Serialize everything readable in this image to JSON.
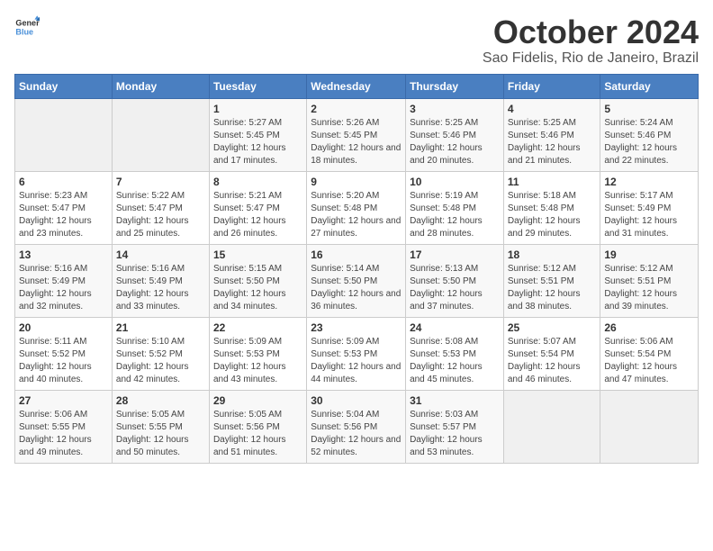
{
  "header": {
    "logo_line1": "General",
    "logo_line2": "Blue",
    "title": "October 2024",
    "subtitle": "Sao Fidelis, Rio de Janeiro, Brazil"
  },
  "days_of_week": [
    "Sunday",
    "Monday",
    "Tuesday",
    "Wednesday",
    "Thursday",
    "Friday",
    "Saturday"
  ],
  "weeks": [
    [
      {
        "day": "",
        "sunrise": "",
        "sunset": "",
        "daylight": ""
      },
      {
        "day": "",
        "sunrise": "",
        "sunset": "",
        "daylight": ""
      },
      {
        "day": "1",
        "sunrise": "Sunrise: 5:27 AM",
        "sunset": "Sunset: 5:45 PM",
        "daylight": "Daylight: 12 hours and 17 minutes."
      },
      {
        "day": "2",
        "sunrise": "Sunrise: 5:26 AM",
        "sunset": "Sunset: 5:45 PM",
        "daylight": "Daylight: 12 hours and 18 minutes."
      },
      {
        "day": "3",
        "sunrise": "Sunrise: 5:25 AM",
        "sunset": "Sunset: 5:46 PM",
        "daylight": "Daylight: 12 hours and 20 minutes."
      },
      {
        "day": "4",
        "sunrise": "Sunrise: 5:25 AM",
        "sunset": "Sunset: 5:46 PM",
        "daylight": "Daylight: 12 hours and 21 minutes."
      },
      {
        "day": "5",
        "sunrise": "Sunrise: 5:24 AM",
        "sunset": "Sunset: 5:46 PM",
        "daylight": "Daylight: 12 hours and 22 minutes."
      }
    ],
    [
      {
        "day": "6",
        "sunrise": "Sunrise: 5:23 AM",
        "sunset": "Sunset: 5:47 PM",
        "daylight": "Daylight: 12 hours and 23 minutes."
      },
      {
        "day": "7",
        "sunrise": "Sunrise: 5:22 AM",
        "sunset": "Sunset: 5:47 PM",
        "daylight": "Daylight: 12 hours and 25 minutes."
      },
      {
        "day": "8",
        "sunrise": "Sunrise: 5:21 AM",
        "sunset": "Sunset: 5:47 PM",
        "daylight": "Daylight: 12 hours and 26 minutes."
      },
      {
        "day": "9",
        "sunrise": "Sunrise: 5:20 AM",
        "sunset": "Sunset: 5:48 PM",
        "daylight": "Daylight: 12 hours and 27 minutes."
      },
      {
        "day": "10",
        "sunrise": "Sunrise: 5:19 AM",
        "sunset": "Sunset: 5:48 PM",
        "daylight": "Daylight: 12 hours and 28 minutes."
      },
      {
        "day": "11",
        "sunrise": "Sunrise: 5:18 AM",
        "sunset": "Sunset: 5:48 PM",
        "daylight": "Daylight: 12 hours and 29 minutes."
      },
      {
        "day": "12",
        "sunrise": "Sunrise: 5:17 AM",
        "sunset": "Sunset: 5:49 PM",
        "daylight": "Daylight: 12 hours and 31 minutes."
      }
    ],
    [
      {
        "day": "13",
        "sunrise": "Sunrise: 5:16 AM",
        "sunset": "Sunset: 5:49 PM",
        "daylight": "Daylight: 12 hours and 32 minutes."
      },
      {
        "day": "14",
        "sunrise": "Sunrise: 5:16 AM",
        "sunset": "Sunset: 5:49 PM",
        "daylight": "Daylight: 12 hours and 33 minutes."
      },
      {
        "day": "15",
        "sunrise": "Sunrise: 5:15 AM",
        "sunset": "Sunset: 5:50 PM",
        "daylight": "Daylight: 12 hours and 34 minutes."
      },
      {
        "day": "16",
        "sunrise": "Sunrise: 5:14 AM",
        "sunset": "Sunset: 5:50 PM",
        "daylight": "Daylight: 12 hours and 36 minutes."
      },
      {
        "day": "17",
        "sunrise": "Sunrise: 5:13 AM",
        "sunset": "Sunset: 5:50 PM",
        "daylight": "Daylight: 12 hours and 37 minutes."
      },
      {
        "day": "18",
        "sunrise": "Sunrise: 5:12 AM",
        "sunset": "Sunset: 5:51 PM",
        "daylight": "Daylight: 12 hours and 38 minutes."
      },
      {
        "day": "19",
        "sunrise": "Sunrise: 5:12 AM",
        "sunset": "Sunset: 5:51 PM",
        "daylight": "Daylight: 12 hours and 39 minutes."
      }
    ],
    [
      {
        "day": "20",
        "sunrise": "Sunrise: 5:11 AM",
        "sunset": "Sunset: 5:52 PM",
        "daylight": "Daylight: 12 hours and 40 minutes."
      },
      {
        "day": "21",
        "sunrise": "Sunrise: 5:10 AM",
        "sunset": "Sunset: 5:52 PM",
        "daylight": "Daylight: 12 hours and 42 minutes."
      },
      {
        "day": "22",
        "sunrise": "Sunrise: 5:09 AM",
        "sunset": "Sunset: 5:53 PM",
        "daylight": "Daylight: 12 hours and 43 minutes."
      },
      {
        "day": "23",
        "sunrise": "Sunrise: 5:09 AM",
        "sunset": "Sunset: 5:53 PM",
        "daylight": "Daylight: 12 hours and 44 minutes."
      },
      {
        "day": "24",
        "sunrise": "Sunrise: 5:08 AM",
        "sunset": "Sunset: 5:53 PM",
        "daylight": "Daylight: 12 hours and 45 minutes."
      },
      {
        "day": "25",
        "sunrise": "Sunrise: 5:07 AM",
        "sunset": "Sunset: 5:54 PM",
        "daylight": "Daylight: 12 hours and 46 minutes."
      },
      {
        "day": "26",
        "sunrise": "Sunrise: 5:06 AM",
        "sunset": "Sunset: 5:54 PM",
        "daylight": "Daylight: 12 hours and 47 minutes."
      }
    ],
    [
      {
        "day": "27",
        "sunrise": "Sunrise: 5:06 AM",
        "sunset": "Sunset: 5:55 PM",
        "daylight": "Daylight: 12 hours and 49 minutes."
      },
      {
        "day": "28",
        "sunrise": "Sunrise: 5:05 AM",
        "sunset": "Sunset: 5:55 PM",
        "daylight": "Daylight: 12 hours and 50 minutes."
      },
      {
        "day": "29",
        "sunrise": "Sunrise: 5:05 AM",
        "sunset": "Sunset: 5:56 PM",
        "daylight": "Daylight: 12 hours and 51 minutes."
      },
      {
        "day": "30",
        "sunrise": "Sunrise: 5:04 AM",
        "sunset": "Sunset: 5:56 PM",
        "daylight": "Daylight: 12 hours and 52 minutes."
      },
      {
        "day": "31",
        "sunrise": "Sunrise: 5:03 AM",
        "sunset": "Sunset: 5:57 PM",
        "daylight": "Daylight: 12 hours and 53 minutes."
      },
      {
        "day": "",
        "sunrise": "",
        "sunset": "",
        "daylight": ""
      },
      {
        "day": "",
        "sunrise": "",
        "sunset": "",
        "daylight": ""
      }
    ]
  ]
}
